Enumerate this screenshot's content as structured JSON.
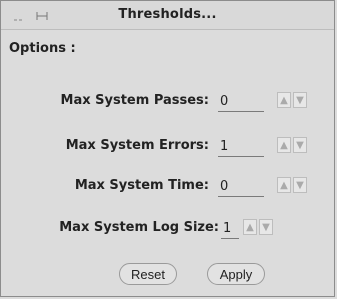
{
  "window": {
    "title": "Thresholds..."
  },
  "section": {
    "title": "Options :"
  },
  "fields": [
    {
      "label": "Max System Passes:",
      "value": "0"
    },
    {
      "label": "Max System Errors:",
      "value": "1"
    },
    {
      "label": "Max System Time:",
      "value": "0"
    },
    {
      "label": "Max System Log Size:",
      "value": "1"
    }
  ],
  "buttons": {
    "reset": "Reset",
    "apply": "Apply"
  },
  "icons": {
    "menu": "menu-icon",
    "pin": "pin-icon",
    "spin_up": "spin-up-icon",
    "spin_down": "spin-down-icon"
  }
}
